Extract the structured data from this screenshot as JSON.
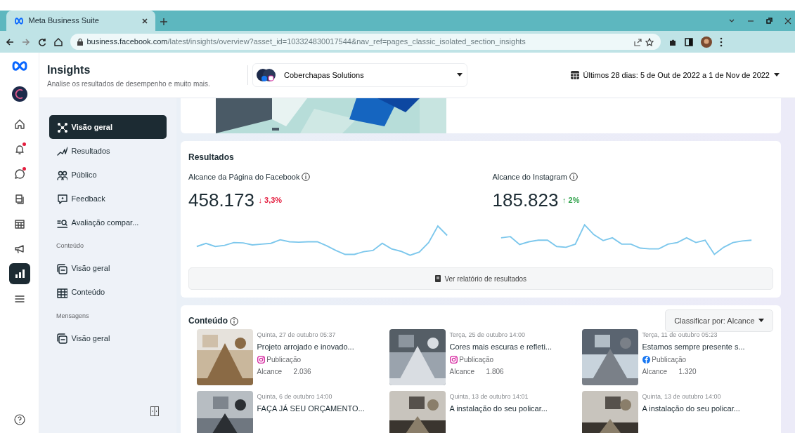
{
  "browser": {
    "tab_title": "Meta Business Suite",
    "url_host": "business.facebook.com",
    "url_path": "/latest/insights/overview?asset_id=103324830017544&nav_ref=pages_classic_isolated_section_insights"
  },
  "header": {
    "title": "Insights",
    "subtitle": "Analise os resultados de desempenho e muito mais.",
    "account": "Coberchapas Solutions",
    "date_range": "Últimos 28 dias: 5 de Out de 2022 a 1 de Nov de 2022"
  },
  "rail": [
    {
      "kind": "home",
      "selected": false,
      "alert": false
    },
    {
      "kind": "bell",
      "selected": false,
      "alert": true
    },
    {
      "kind": "chat",
      "selected": false,
      "alert": true
    },
    {
      "kind": "pages",
      "selected": false,
      "alert": false
    },
    {
      "kind": "calendar",
      "selected": false,
      "alert": false
    },
    {
      "kind": "megaphone",
      "selected": false,
      "alert": false
    },
    {
      "kind": "chart",
      "selected": true,
      "alert": false
    },
    {
      "kind": "menu",
      "selected": false,
      "alert": false
    }
  ],
  "sidebar": {
    "sections": [
      {
        "items": [
          {
            "label": "Visão geral",
            "selected": true
          },
          {
            "label": "Resultados",
            "selected": false
          },
          {
            "label": "Público",
            "selected": false
          },
          {
            "label": "Feedback",
            "selected": false
          },
          {
            "label": "Avaliação compar...",
            "selected": false
          }
        ]
      },
      {
        "title": "Conteúdo",
        "items": [
          {
            "label": "Visão geral",
            "selected": false
          },
          {
            "label": "Conteúdo",
            "selected": false
          }
        ]
      },
      {
        "title": "Mensagens",
        "items": [
          {
            "label": "Visão geral",
            "selected": false
          }
        ]
      }
    ]
  },
  "results": {
    "title": "Resultados",
    "button": "Ver relatório de resultados",
    "metrics": [
      {
        "label": "Alcance da Página do Facebook",
        "value": "458.173",
        "change": "↓ 3,3%",
        "color": "#e41e3f"
      },
      {
        "label": "Alcance do Instagram",
        "value": "185.823",
        "change": "↑ 2%",
        "color": "#31a24c"
      }
    ]
  },
  "content": {
    "title": "Conteúdo",
    "sort": "Classificar por: Alcance",
    "posts": [
      {
        "date": "Quinta, 27 de outubro 05:37",
        "text": "Projeto arrojado e inovado...",
        "kind": "instagram",
        "type": "Publicação",
        "metric": "Alcance",
        "reach": "2.036"
      },
      {
        "date": "Terça, 25 de outubro 14:00",
        "text": "Cores mais escuras e refleti...",
        "kind": "instagram",
        "type": "Publicação",
        "metric": "Alcance",
        "reach": "1.806"
      },
      {
        "date": "Terça, 11 de outubro 05:23",
        "text": "Estamos sempre presente s...",
        "kind": "facebook",
        "type": "Publicação",
        "metric": "Alcance",
        "reach": "1.320"
      },
      {
        "date": "Quinta, 6 de outubro 14:00",
        "text": "FAÇA JÁ SEU ORÇAMENTO..."
      },
      {
        "date": "Quinta, 13 de outubro 14:01",
        "text": "A instalação do seu policar..."
      },
      {
        "date": "Quinta, 13 de outubro 14:00",
        "text": "A instalação do seu policar..."
      }
    ]
  }
}
